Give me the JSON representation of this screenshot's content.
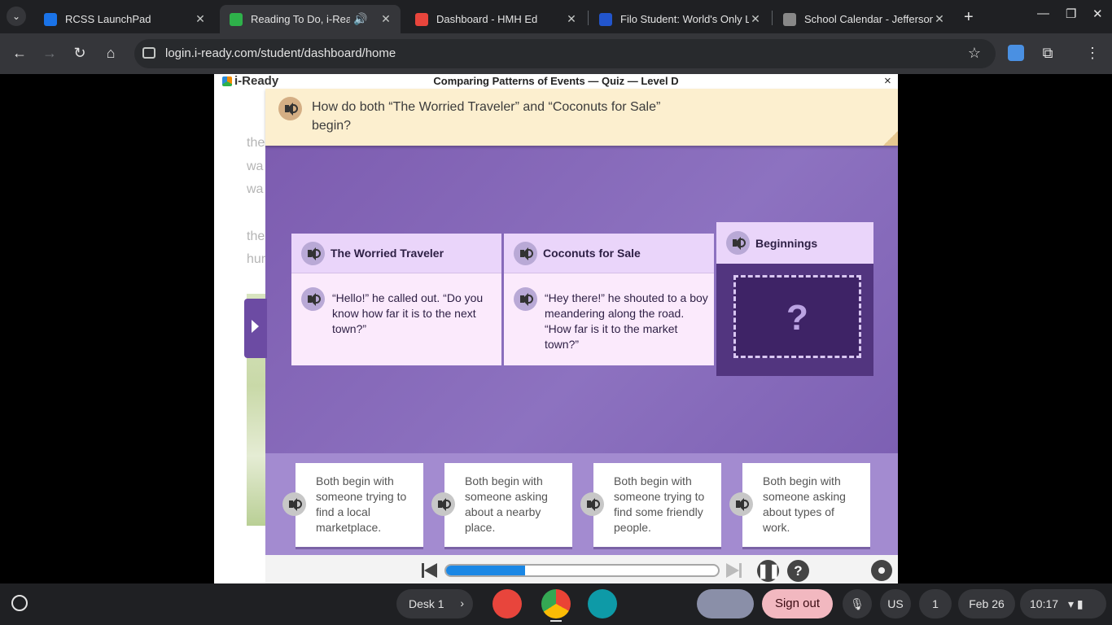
{
  "browser": {
    "tabs": [
      {
        "title": "RCSS LaunchPad",
        "favicon_color": "#1a73e8"
      },
      {
        "title": "Reading To Do, i-Ready",
        "favicon_color": "#2eb14a"
      },
      {
        "title": "Dashboard - HMH Ed",
        "favicon_color": "#e8453c"
      },
      {
        "title": "Filo Student: World's Only L",
        "favicon_color": "#2255cc"
      },
      {
        "title": "School Calendar - Jefferson",
        "favicon_color": "#888888"
      }
    ],
    "url": "login.i-ready.com/student/dashboard/home"
  },
  "page": {
    "logo": "i-Ready",
    "quiz_title": "Comparing Patterns of Events — Quiz — Level D",
    "close": "×",
    "faded_text": [
      "the",
      "wa",
      "wa",
      "the",
      "hur"
    ]
  },
  "question": {
    "text": "How do both “The Worried Traveler” and “Coconuts for Sale” begin?"
  },
  "cards": [
    {
      "title": "The Worried Traveler",
      "text": "“Hello!” he called out. “Do you know how far it is to the next town?”"
    },
    {
      "title": "Coconuts for Sale",
      "text": "“Hey there!” he shouted to a boy meandering along the road. “How far is it to the market town?”"
    }
  ],
  "beginnings": {
    "title": "Beginnings",
    "placeholder": "?"
  },
  "answers": [
    "Both begin with someone trying to find a local marketplace.",
    "Both begin with someone asking about a nearby place.",
    "Both begin with someone trying to find some friendly people.",
    "Both begin with someone asking about types of work."
  ],
  "controls": {
    "progress_fraction": 0.29,
    "help": "?"
  },
  "shelf": {
    "desk": "Desk 1",
    "sign_out": "Sign out",
    "ime": "US",
    "notifications": "1",
    "date": "Feb 26",
    "time": "10:17"
  }
}
